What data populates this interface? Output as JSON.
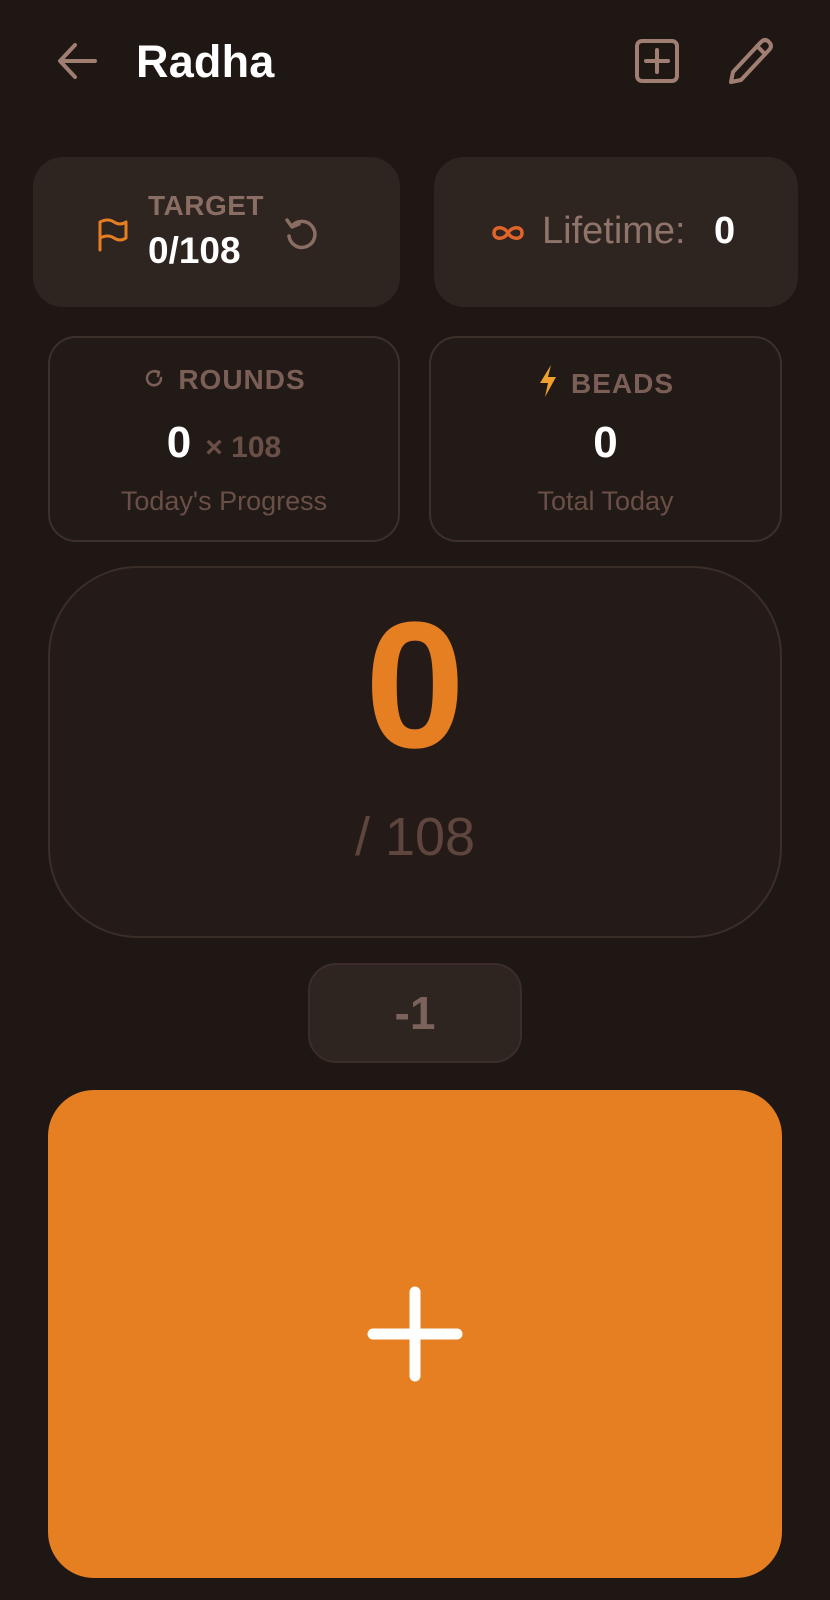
{
  "header": {
    "title": "Radha",
    "back_icon": "arrow-left-icon",
    "add_icon": "plus-square-icon",
    "edit_icon": "pencil-icon"
  },
  "target_card": {
    "label": "TARGET",
    "value": "0/108",
    "icon": "flag-icon",
    "reset_icon": "reset-icon"
  },
  "lifetime_card": {
    "label": "Lifetime:",
    "value": "0",
    "icon": "infinity-icon"
  },
  "rounds": {
    "label": "ROUNDS",
    "value": "0",
    "multiplier": "× 108",
    "subtitle": "Today's Progress",
    "icon": "refresh-icon"
  },
  "beads": {
    "label": "BEADS",
    "value": "0",
    "subtitle": "Total Today",
    "icon": "lightning-icon"
  },
  "counter": {
    "value": "0",
    "target": "/ 108"
  },
  "decrement": {
    "label": "-1"
  },
  "increment": {
    "icon": "plus-icon"
  },
  "colors": {
    "background": "#1f1714",
    "accent": "#e67e22",
    "card": "#2e2420",
    "muted_text": "#7b5f56"
  }
}
